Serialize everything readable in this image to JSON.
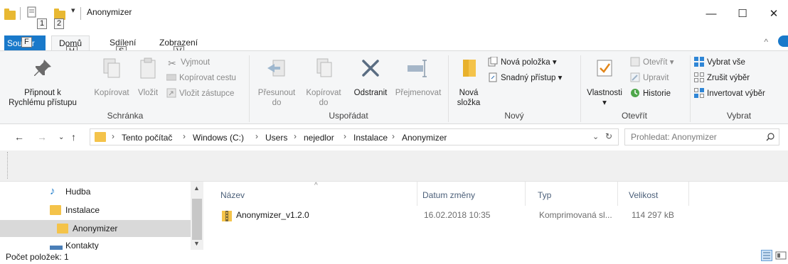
{
  "window": {
    "title": "Anonymizer",
    "keytips": {
      "qa1": "1",
      "qa2": "2",
      "file": "F",
      "home": "H",
      "share": "S",
      "view": "V"
    },
    "controls": {
      "minimize": "—",
      "maximize": "☐",
      "close": "✕"
    }
  },
  "ribbon_tabs": {
    "file": "Soubor",
    "home": "Domů",
    "share": "Sdílení",
    "view": "Zobrazení"
  },
  "ribbon": {
    "clipboard": {
      "label": "Schránka",
      "pin_line1": "Připnout k",
      "pin_line2": "Rychlému přístupu",
      "copy": "Kopírovat",
      "paste": "Vložit",
      "cut": "Vyjmout",
      "copy_path": "Kopírovat cestu",
      "paste_shortcut": "Vložit zástupce"
    },
    "organize": {
      "label": "Uspořádat",
      "move_line1": "Přesunout",
      "move_line2": "do",
      "copyto_line1": "Kopírovat",
      "copyto_line2": "do",
      "delete": "Odstranit",
      "rename": "Přejmenovat"
    },
    "new": {
      "label": "Nový",
      "folder_line1": "Nová",
      "folder_line2": "složka",
      "new_item": "Nová položka",
      "easy_access": "Snadný přístup"
    },
    "open": {
      "label": "Otevřít",
      "properties": "Vlastnosti",
      "open": "Otevřít",
      "edit": "Upravit",
      "history": "Historie"
    },
    "select": {
      "label": "Vybrat",
      "select_all": "Vybrat vše",
      "select_none": "Zrušit výběr",
      "invert": "Invertovat výběr"
    }
  },
  "address": {
    "crumbs": [
      "Tento počítač",
      "Windows (C:)",
      "Users",
      "nejedlor",
      "Instalace",
      "Anonymizer"
    ],
    "search_placeholder": "Prohledat: Anonymizer"
  },
  "nav_pane": {
    "items": [
      {
        "label": "Hudba",
        "icon": "music-note-icon",
        "selected": false
      },
      {
        "label": "Instalace",
        "icon": "folder-icon",
        "selected": false
      },
      {
        "label": "Anonymizer",
        "icon": "folder-icon",
        "selected": true
      },
      {
        "label": "Kontakty",
        "icon": "contacts-icon",
        "selected": false
      }
    ]
  },
  "file_list": {
    "columns": [
      "Název",
      "Datum změny",
      "Typ",
      "Velikost"
    ],
    "rows": [
      {
        "name": "Anonymizer_v1.2.0",
        "date": "16.02.2018 10:35",
        "type": "Komprimovaná sl...",
        "size": "114 297 kB",
        "icon": "zip-folder-icon"
      }
    ]
  },
  "status": {
    "item_count": "Počet položek: 1"
  },
  "colors": {
    "accent": "#1979ca",
    "folder": "#f4c34a",
    "selected_bg": "#d9d9d9",
    "ribbon_bg": "#f5f6f7"
  }
}
